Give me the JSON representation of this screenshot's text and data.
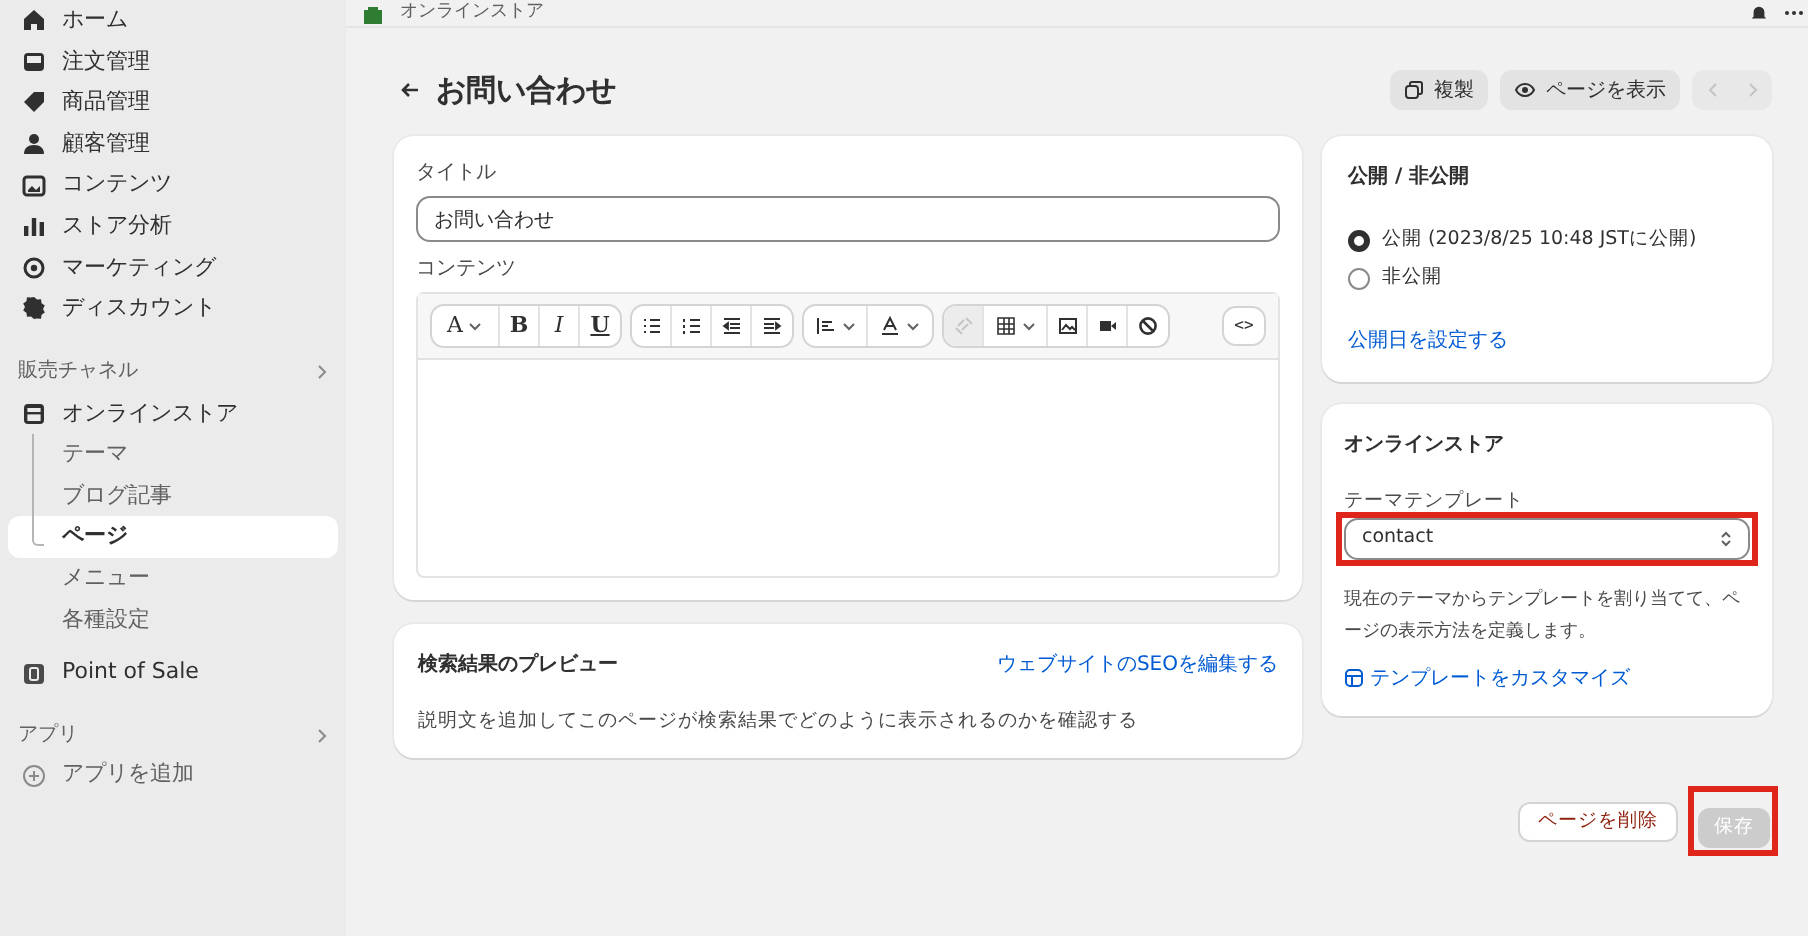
{
  "top_bar": {
    "store_name": "オンラインストア"
  },
  "sidebar": {
    "items": [
      {
        "kind": "nav",
        "label": "ホーム"
      },
      {
        "kind": "nav",
        "label": "注文管理"
      },
      {
        "kind": "nav",
        "label": "商品管理"
      },
      {
        "kind": "nav",
        "label": "顧客管理"
      },
      {
        "kind": "nav",
        "label": "コンテンツ"
      },
      {
        "kind": "nav",
        "label": "ストア分析"
      },
      {
        "kind": "nav",
        "label": "マーケティング"
      },
      {
        "kind": "nav",
        "label": "ディスカウント"
      },
      {
        "kind": "section",
        "label": "販売チャネル"
      },
      {
        "kind": "channel",
        "label": "オンラインストア",
        "children": [
          {
            "label": "テーマ",
            "selected": false
          },
          {
            "label": "ブログ記事",
            "selected": false
          },
          {
            "label": "ページ",
            "selected": true
          },
          {
            "label": "メニュー",
            "selected": false
          },
          {
            "label": "各種設定",
            "selected": false
          }
        ]
      },
      {
        "kind": "channel",
        "label": "Point of Sale"
      },
      {
        "kind": "section",
        "label": "アプリ"
      },
      {
        "kind": "add",
        "label": "アプリを追加"
      }
    ]
  },
  "header": {
    "title": "お問い合わせ",
    "actions": [
      "複製",
      "ページを表示"
    ]
  },
  "editor": {
    "title_label": "タイトル",
    "title_value": "お問い合わせ",
    "content_label": "コンテンツ",
    "toolbar": {
      "font": "A",
      "bold": "B",
      "italic": "I",
      "underline": "U",
      "code": "<>",
      "link_disabled": true
    }
  },
  "seo": {
    "title": "検索結果のプレビュー",
    "link": "ウェブサイトのSEOを編集する",
    "description": "説明文を追加してこのページが検索結果でどのように表示されるのかを確認する"
  },
  "visibility": {
    "title": "公開 / 非公開",
    "options": [
      {
        "label": "公開 (2023/8/25 10:48 JSTに公開)",
        "selected": true
      },
      {
        "label": "非公開",
        "selected": false
      }
    ],
    "link": "公開日を設定する"
  },
  "online_store": {
    "title": "オンラインストア",
    "template_label": "テーマテンプレート",
    "template_value": "contact",
    "help": "現在のテーマからテンプレートを割り当てて、ページの表示方法を定義します。",
    "link": "テンプレートをカスタマイズ"
  },
  "footer": {
    "delete": "ページを削除",
    "save": "保存",
    "save_disabled": true
  }
}
